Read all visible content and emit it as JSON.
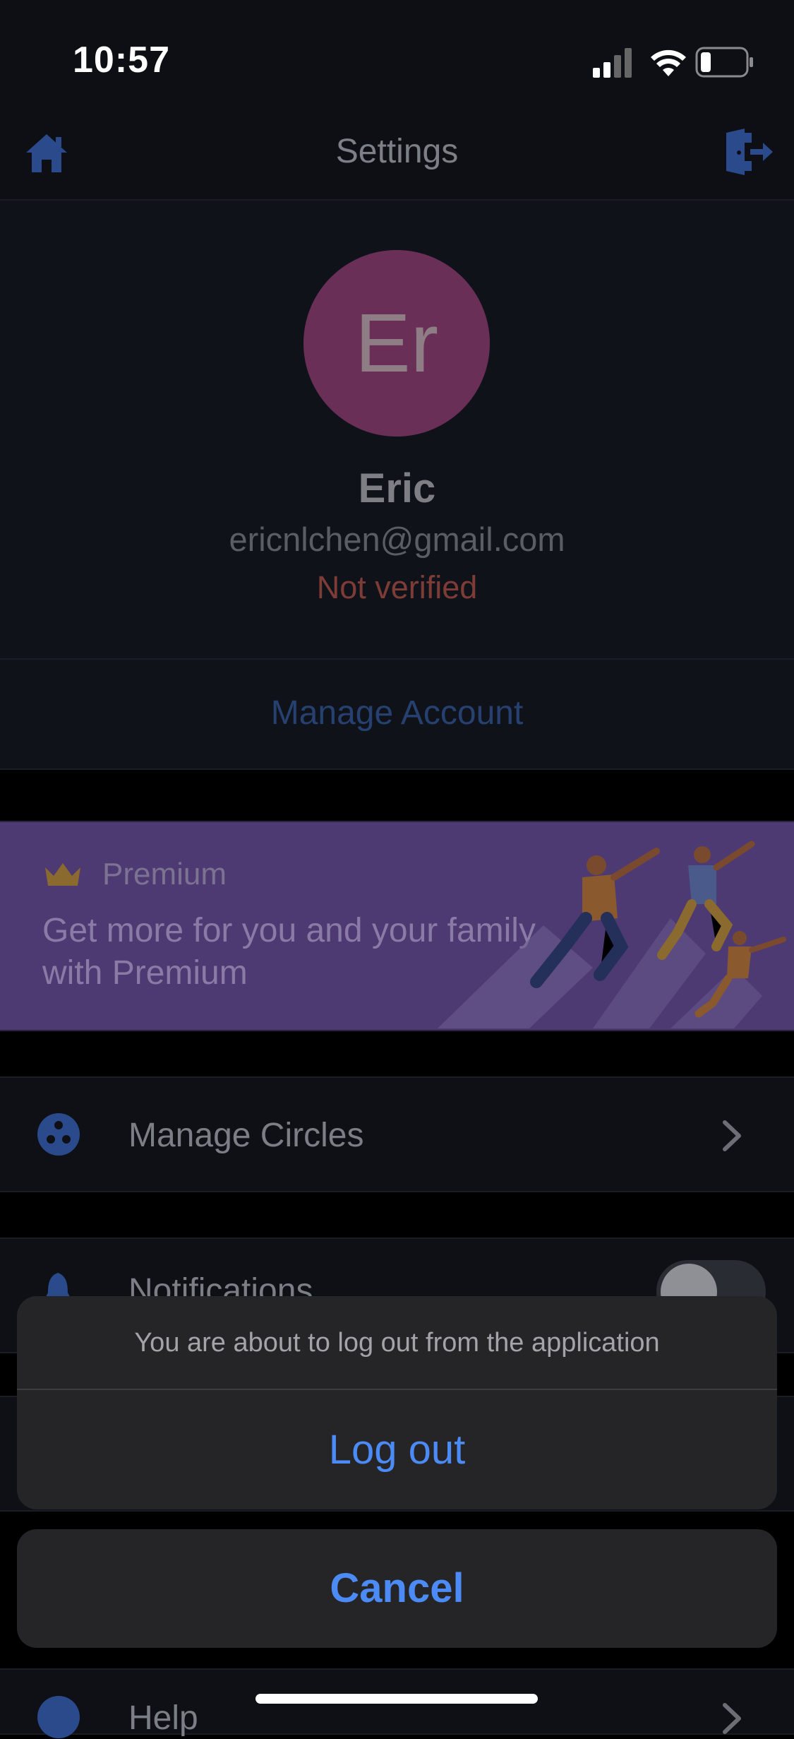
{
  "status_bar": {
    "time": "10:57"
  },
  "nav": {
    "title": "Settings",
    "left_icon": "home-icon",
    "right_icon": "logout-icon"
  },
  "profile": {
    "avatar_initials": "Er",
    "avatar_color": "#6a2f57",
    "name": "Eric",
    "email": "ericnlchen@gmail.com",
    "verification": "Not verified"
  },
  "manage_account": {
    "label": "Manage Account"
  },
  "premium": {
    "tag": "Premium",
    "text": "Get more for you and your family with Premium"
  },
  "rows": {
    "circles": {
      "label": "Manage Circles"
    },
    "notifications": {
      "label": "Notifications"
    },
    "help": {
      "label": "Help"
    }
  },
  "action_sheet": {
    "message": "You are about to log out from the application",
    "confirm_label": "Log out",
    "cancel_label": "Cancel"
  },
  "colors": {
    "accent": "#4c8bf5",
    "background": "#0d0f15",
    "premium": "#4d3a73",
    "warning": "#7e3c37"
  }
}
